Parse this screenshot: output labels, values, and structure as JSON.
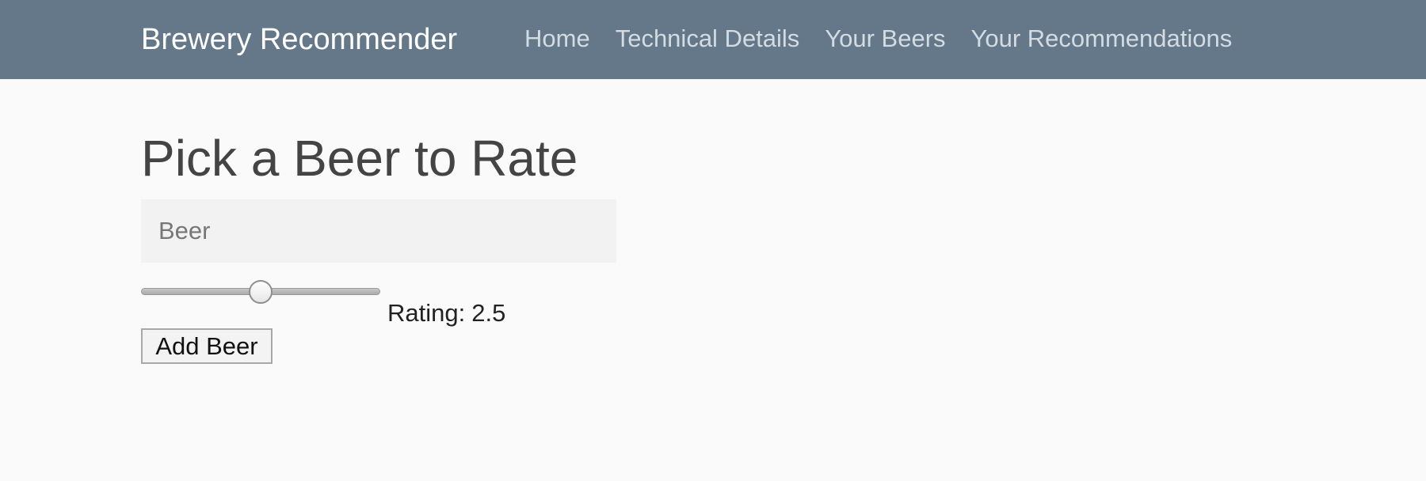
{
  "navbar": {
    "brand": "Brewery Recommender",
    "background_color": "#647889",
    "links": [
      {
        "label": "Home"
      },
      {
        "label": "Technical Details"
      },
      {
        "label": "Your Beers"
      },
      {
        "label": "Your Recommendations"
      }
    ]
  },
  "main": {
    "title": "Pick a Beer to Rate",
    "beer_input": {
      "value": "",
      "placeholder": "Beer"
    },
    "rating_slider": {
      "min": 0,
      "max": 5,
      "value": 2.5
    },
    "rating_label": "Rating:",
    "rating_value": "2.5",
    "add_button_label": "Add Beer"
  }
}
